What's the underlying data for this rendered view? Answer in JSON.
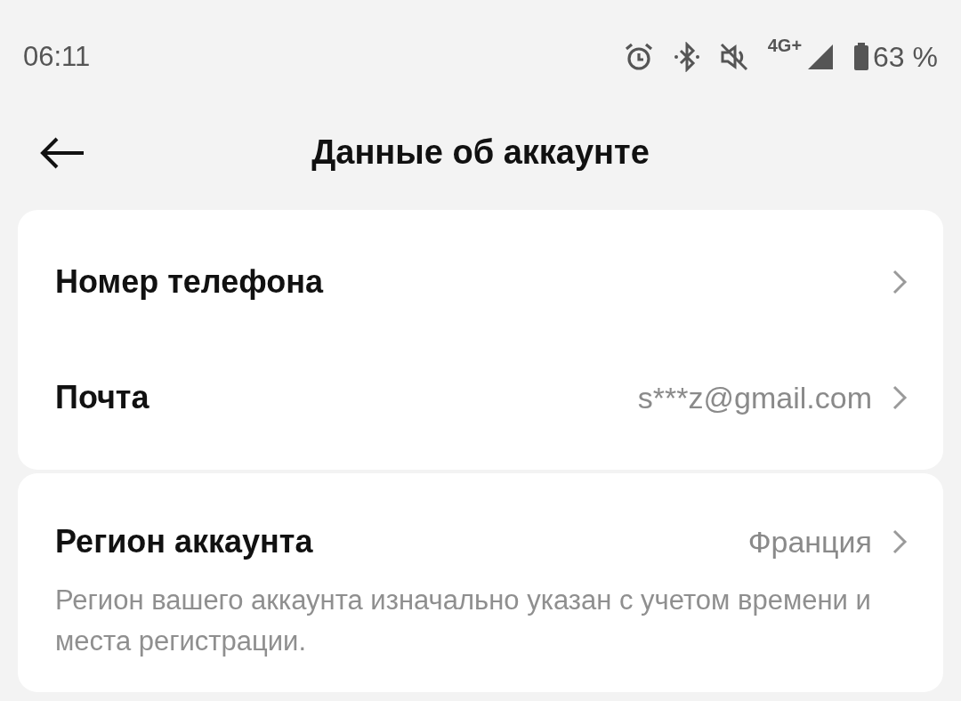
{
  "status_bar": {
    "time": "06:11",
    "network": "4G+",
    "battery": "63 %"
  },
  "header": {
    "title": "Данные об аккаунте"
  },
  "sections": [
    {
      "rows": [
        {
          "label": "Номер телефона"
        },
        {
          "label": "Почта",
          "value": "s***z@gmail.com"
        }
      ]
    },
    {
      "rows": [
        {
          "label": "Регион аккаунта",
          "value": "Франция"
        }
      ],
      "note": "Регион вашего аккаунта изначально указан с учетом времени и места регистрации."
    }
  ]
}
